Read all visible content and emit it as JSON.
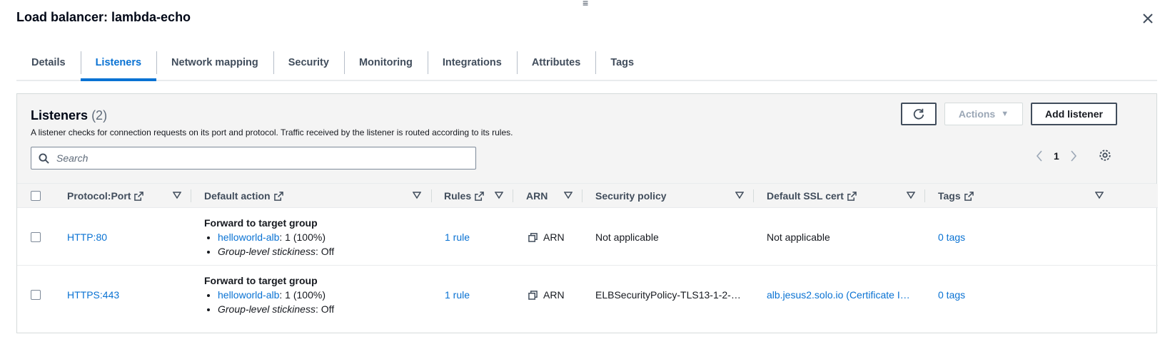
{
  "header": {
    "title": "Load balancer: lambda-echo"
  },
  "tabs": [
    {
      "label": "Details",
      "active": false
    },
    {
      "label": "Listeners",
      "active": true
    },
    {
      "label": "Network mapping",
      "active": false
    },
    {
      "label": "Security",
      "active": false
    },
    {
      "label": "Monitoring",
      "active": false
    },
    {
      "label": "Integrations",
      "active": false
    },
    {
      "label": "Attributes",
      "active": false
    },
    {
      "label": "Tags",
      "active": false
    }
  ],
  "panel": {
    "title": "Listeners",
    "count": "(2)",
    "description": "A listener checks for connection requests on its port and protocol. Traffic received by the listener is routed according to its rules.",
    "actions_label": "Actions",
    "add_listener_label": "Add listener",
    "search_placeholder": "Search",
    "page": "1"
  },
  "columns": {
    "protocol_port": "Protocol:Port",
    "default_action": "Default action",
    "rules": "Rules",
    "arn": "ARN",
    "security_policy": "Security policy",
    "default_ssl_cert": "Default SSL cert",
    "tags": "Tags"
  },
  "rows": [
    {
      "protocol_port": "HTTP:80",
      "action_title": "Forward to target group",
      "target_link": "helloworld-alb",
      "target_weight": ": 1 (100%)",
      "stickiness_label": "Group-level stickiness",
      "stickiness_value": ": Off",
      "rules": "1 rule",
      "arn": "ARN",
      "security_policy": "Not applicable",
      "ssl_cert": "Not applicable",
      "tags": "0 tags"
    },
    {
      "protocol_port": "HTTPS:443",
      "action_title": "Forward to target group",
      "target_link": "helloworld-alb",
      "target_weight": ": 1 (100%)",
      "stickiness_label": "Group-level stickiness",
      "stickiness_value": ": Off",
      "rules": "1 rule",
      "arn": "ARN",
      "security_policy": "ELBSecurityPolicy-TLS13-1-2-…",
      "ssl_cert": "alb.jesus2.solo.io (Certificate I…",
      "tags": "0 tags"
    }
  ],
  "colors": {
    "accent": "#0972d3",
    "text": "#16191f",
    "muted": "#5f6b7a"
  }
}
